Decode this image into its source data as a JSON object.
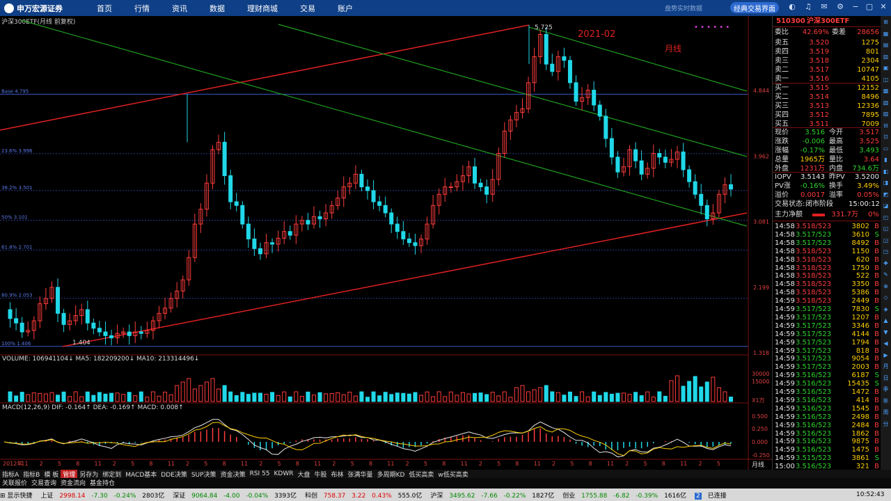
{
  "topbar": {
    "brand": "申万宏源证券",
    "nav": [
      "首页",
      "行情",
      "资讯",
      "数据",
      "理财商城",
      "交易",
      "账户"
    ],
    "hint": "盘势实时数据",
    "classic_button": "经典交易界面"
  },
  "chart": {
    "title": "沪深300ETF(月线 前复权)",
    "annot_date": "2021-02",
    "annot_period": "月线",
    "high_label": "5.725",
    "low_label": "1.404",
    "fib_levels": [
      {
        "label": "Base 4.795",
        "value": 4.795
      },
      {
        "label": "23.6% 3.996",
        "value": 3.996
      },
      {
        "label": "38.2% 3.501",
        "value": 3.501
      },
      {
        "label": "50% 3.101",
        "value": 3.101
      },
      {
        "label": "61.8% 2.701",
        "value": 2.701
      },
      {
        "label": "80.9% 2.053",
        "value": 2.053
      },
      {
        "label": "100% 1.406",
        "value": 1.406
      }
    ],
    "price_ticks": [
      "4.844",
      "3.962",
      "3.081",
      "2.199",
      "1.318"
    ],
    "volume_label": "VOLUME: 106941104↓  MA5: 182209200↓  MA10: 213314496↓",
    "volume_ticks": [
      "30000",
      "15000",
      "X1万"
    ],
    "macd_label": "MACD(12,26,9)  DIF: -0.164↑  DEA: -0.169↑  MACD: 0.008↑",
    "macd_ticks": [
      "0.500",
      "0.250",
      "0.000",
      "-0.250"
    ],
    "x_labels": [
      "2012年",
      "11",
      "2",
      "5",
      "8",
      "11",
      "2",
      "5",
      "8",
      "11",
      "2",
      "5",
      "8",
      "11",
      "2",
      "5",
      "8",
      "11",
      "2",
      "5",
      "8",
      "11",
      "2",
      "5",
      "8",
      "11",
      "2",
      "5",
      "8",
      "11",
      "2",
      "5",
      "8",
      "11",
      "2",
      "5",
      "8",
      "11",
      "2",
      "5"
    ],
    "period_label": "月线"
  },
  "chart_data": {
    "type": "candlestick",
    "title": "沪深300ETF(月线 前复权)",
    "ylim": [
      1.318,
      5.725
    ],
    "key_points": [
      {
        "label": "2021-02 high",
        "value": 5.725
      },
      {
        "label": "low",
        "value": 1.404
      }
    ],
    "fib_retracement": [
      4.795,
      3.996,
      3.501,
      3.101,
      2.701,
      2.053,
      1.406
    ],
    "indicators": {
      "volume": 106941104,
      "ma5": 182209200,
      "ma10": 213314496,
      "dif": -0.164,
      "dea": -0.169,
      "macd": 0.008
    }
  },
  "quote": {
    "code": "510300",
    "name": "沪深300ETF",
    "wb_label": "委比",
    "wb": "42.69%",
    "wc_label": "委差",
    "wc": "28656",
    "asks": [
      {
        "label": "卖五",
        "price": "3.520",
        "vol": "1275"
      },
      {
        "label": "卖四",
        "price": "3.519",
        "vol": "801"
      },
      {
        "label": "卖三",
        "price": "3.518",
        "vol": "2304"
      },
      {
        "label": "卖二",
        "price": "3.517",
        "vol": "10747"
      },
      {
        "label": "卖一",
        "price": "3.516",
        "vol": "4105"
      }
    ],
    "bids": [
      {
        "label": "买一",
        "price": "3.515",
        "vol": "12152"
      },
      {
        "label": "买二",
        "price": "3.514",
        "vol": "8496"
      },
      {
        "label": "买三",
        "price": "3.513",
        "vol": "12336"
      },
      {
        "label": "买四",
        "price": "3.512",
        "vol": "7895"
      },
      {
        "label": "买五",
        "price": "3.511",
        "vol": "7009"
      }
    ],
    "stats": [
      {
        "l1": "现价",
        "v1": "3.516",
        "c1": "grn",
        "l2": "今开",
        "v2": "3.517",
        "c2": "red"
      },
      {
        "l1": "涨跌",
        "v1": "-0.006",
        "c1": "grn",
        "l2": "最高",
        "v2": "3.525",
        "c2": "red"
      },
      {
        "l1": "涨幅",
        "v1": "-0.17%",
        "c1": "grn",
        "l2": "最低",
        "v2": "3.493",
        "c2": "grn"
      },
      {
        "l1": "总量",
        "v1": "1965万",
        "c1": "yel",
        "l2": "量比",
        "v2": "3.64",
        "c2": "red"
      },
      {
        "l1": "外盘",
        "v1": "1231万",
        "c1": "red",
        "l2": "内盘",
        "v2": "734.6万",
        "c2": "grn"
      }
    ],
    "iopv": [
      {
        "l1": "IOPV",
        "v1": "3.5143",
        "c1": "wht",
        "l2": "昨PV",
        "v2": "3.5200",
        "c2": "wht"
      },
      {
        "l1": "PV涨",
        "v1": "-0.16%",
        "c1": "grn",
        "l2": "换手",
        "v2": "3.49%",
        "c2": "yel"
      },
      {
        "l1": "溢价",
        "v1": "0.0017",
        "c1": "red",
        "l2": "溢率",
        "v2": "0.05%",
        "c2": "red"
      }
    ],
    "trade_state_label": "交易状态:",
    "trade_state": "闭市阶段",
    "trade_time": "15:00:12",
    "net_label": "主力净额",
    "net_value": "331.7万",
    "net_pct": "0%"
  },
  "ticks": [
    {
      "t": "14:58",
      "p": "3.518/523",
      "c": "red",
      "v": "3802",
      "s": "B"
    },
    {
      "t": "14:58",
      "p": "3.517/523",
      "c": "grn",
      "v": "3610",
      "s": "S"
    },
    {
      "t": "14:58",
      "p": "3.517/523",
      "c": "grn",
      "v": "8492",
      "s": "B"
    },
    {
      "t": "14:58",
      "p": "3.518/523",
      "c": "red",
      "v": "1150",
      "s": "B"
    },
    {
      "t": "14:58",
      "p": "3.518/523",
      "c": "red",
      "v": "620",
      "s": "B"
    },
    {
      "t": "14:58",
      "p": "3.518/523",
      "c": "red",
      "v": "1750",
      "s": "B"
    },
    {
      "t": "14:58",
      "p": "3.518/523",
      "c": "red",
      "v": "522",
      "s": "B"
    },
    {
      "t": "14:58",
      "p": "3.518/523",
      "c": "red",
      "v": "3350",
      "s": "B"
    },
    {
      "t": "14:58",
      "p": "3.518/523",
      "c": "red",
      "v": "5386",
      "s": "B"
    },
    {
      "t": "14:59",
      "p": "3.518/523",
      "c": "red",
      "v": "2449",
      "s": "B"
    },
    {
      "t": "14:59",
      "p": "3.517/523",
      "c": "grn",
      "v": "7830",
      "s": "S"
    },
    {
      "t": "14:59",
      "p": "3.517/523",
      "c": "grn",
      "v": "1207",
      "s": "B"
    },
    {
      "t": "14:59",
      "p": "3.517/523",
      "c": "grn",
      "v": "3346",
      "s": "B"
    },
    {
      "t": "14:59",
      "p": "3.517/523",
      "c": "grn",
      "v": "4144",
      "s": "B"
    },
    {
      "t": "14:59",
      "p": "3.517/523",
      "c": "grn",
      "v": "1794",
      "s": "B"
    },
    {
      "t": "14:59",
      "p": "3.517/523",
      "c": "grn",
      "v": "818",
      "s": "B"
    },
    {
      "t": "14:59",
      "p": "3.517/523",
      "c": "grn",
      "v": "9054",
      "s": "B"
    },
    {
      "t": "14:59",
      "p": "3.517/523",
      "c": "grn",
      "v": "2003",
      "s": "B"
    },
    {
      "t": "14:59",
      "p": "3.516/523",
      "c": "grn",
      "v": "6187",
      "s": "S"
    },
    {
      "t": "14:59",
      "p": "3.516/523",
      "c": "grn",
      "v": "15435",
      "s": "S"
    },
    {
      "t": "14:59",
      "p": "3.516/523",
      "c": "grn",
      "v": "1472",
      "s": "B"
    },
    {
      "t": "14:59",
      "p": "3.516/523",
      "c": "grn",
      "v": "414",
      "s": "B"
    },
    {
      "t": "14:59",
      "p": "3.516/523",
      "c": "grn",
      "v": "1545",
      "s": "B"
    },
    {
      "t": "14:59",
      "p": "3.516/523",
      "c": "grn",
      "v": "2498",
      "s": "B"
    },
    {
      "t": "14:59",
      "p": "3.516/523",
      "c": "grn",
      "v": "2484",
      "s": "B"
    },
    {
      "t": "14:59",
      "p": "3.516/523",
      "c": "grn",
      "v": "1862",
      "s": "B"
    },
    {
      "t": "14:59",
      "p": "3.516/523",
      "c": "grn",
      "v": "9875",
      "s": "B"
    },
    {
      "t": "14:59",
      "p": "3.516/523",
      "c": "grn",
      "v": "1475",
      "s": "B"
    },
    {
      "t": "14:59",
      "p": "3.515/523",
      "c": "grn",
      "v": "3861",
      "s": "S"
    },
    {
      "t": "15:00",
      "p": "3.516/523",
      "c": "grn",
      "v": "321",
      "s": "B"
    }
  ],
  "tabs_row1": [
    "指标A",
    "指标B",
    "模 板",
    "管理",
    "另存为",
    "绑定到",
    "MACD基本",
    "DDE决策",
    "SUP决策",
    "资金决策",
    "RSI 55",
    "KDWR",
    "大盘",
    "牛股",
    "布林",
    "张满华量",
    "多周期KD",
    "低买高卖",
    "w低买高卖"
  ],
  "tabs_row2": [
    "关联报价",
    "交易查询",
    "资金流向",
    "基金持仓"
  ],
  "status": {
    "label_display": "显示快捷",
    "sh_name": "上证",
    "sh_val": "2998.14",
    "sh_chg": "-7.30",
    "sh_pct": "-0.24%",
    "sh_amt": "2803亿",
    "sz_name": "深证",
    "sz_val": "9064.84",
    "sz_chg": "-4.00",
    "sz_pct": "-0.04%",
    "sz_amt": "3393亿",
    "kc_name": "科创",
    "kc_val": "758.37",
    "kc_chg": "3.22",
    "kc_pct": "0.43%",
    "kc_amt": "555.0亿",
    "hs_name": "沪深",
    "hs_val": "3495.62",
    "hs_chg": "-7.66",
    "hs_pct": "-0.22%",
    "hs_amt": "1827亿",
    "cy_name": "创业",
    "cy_val": "1755.88",
    "cy_chg": "-6.82",
    "cy_pct": "-0.39%",
    "cy_amt": "1616亿",
    "conn": "已连接",
    "time": "10:52:43"
  },
  "colors": {
    "up": "#ff3c3c",
    "down": "#2ed42e",
    "candle_down": "#20d8e8",
    "topbar": "#0f3f86"
  }
}
